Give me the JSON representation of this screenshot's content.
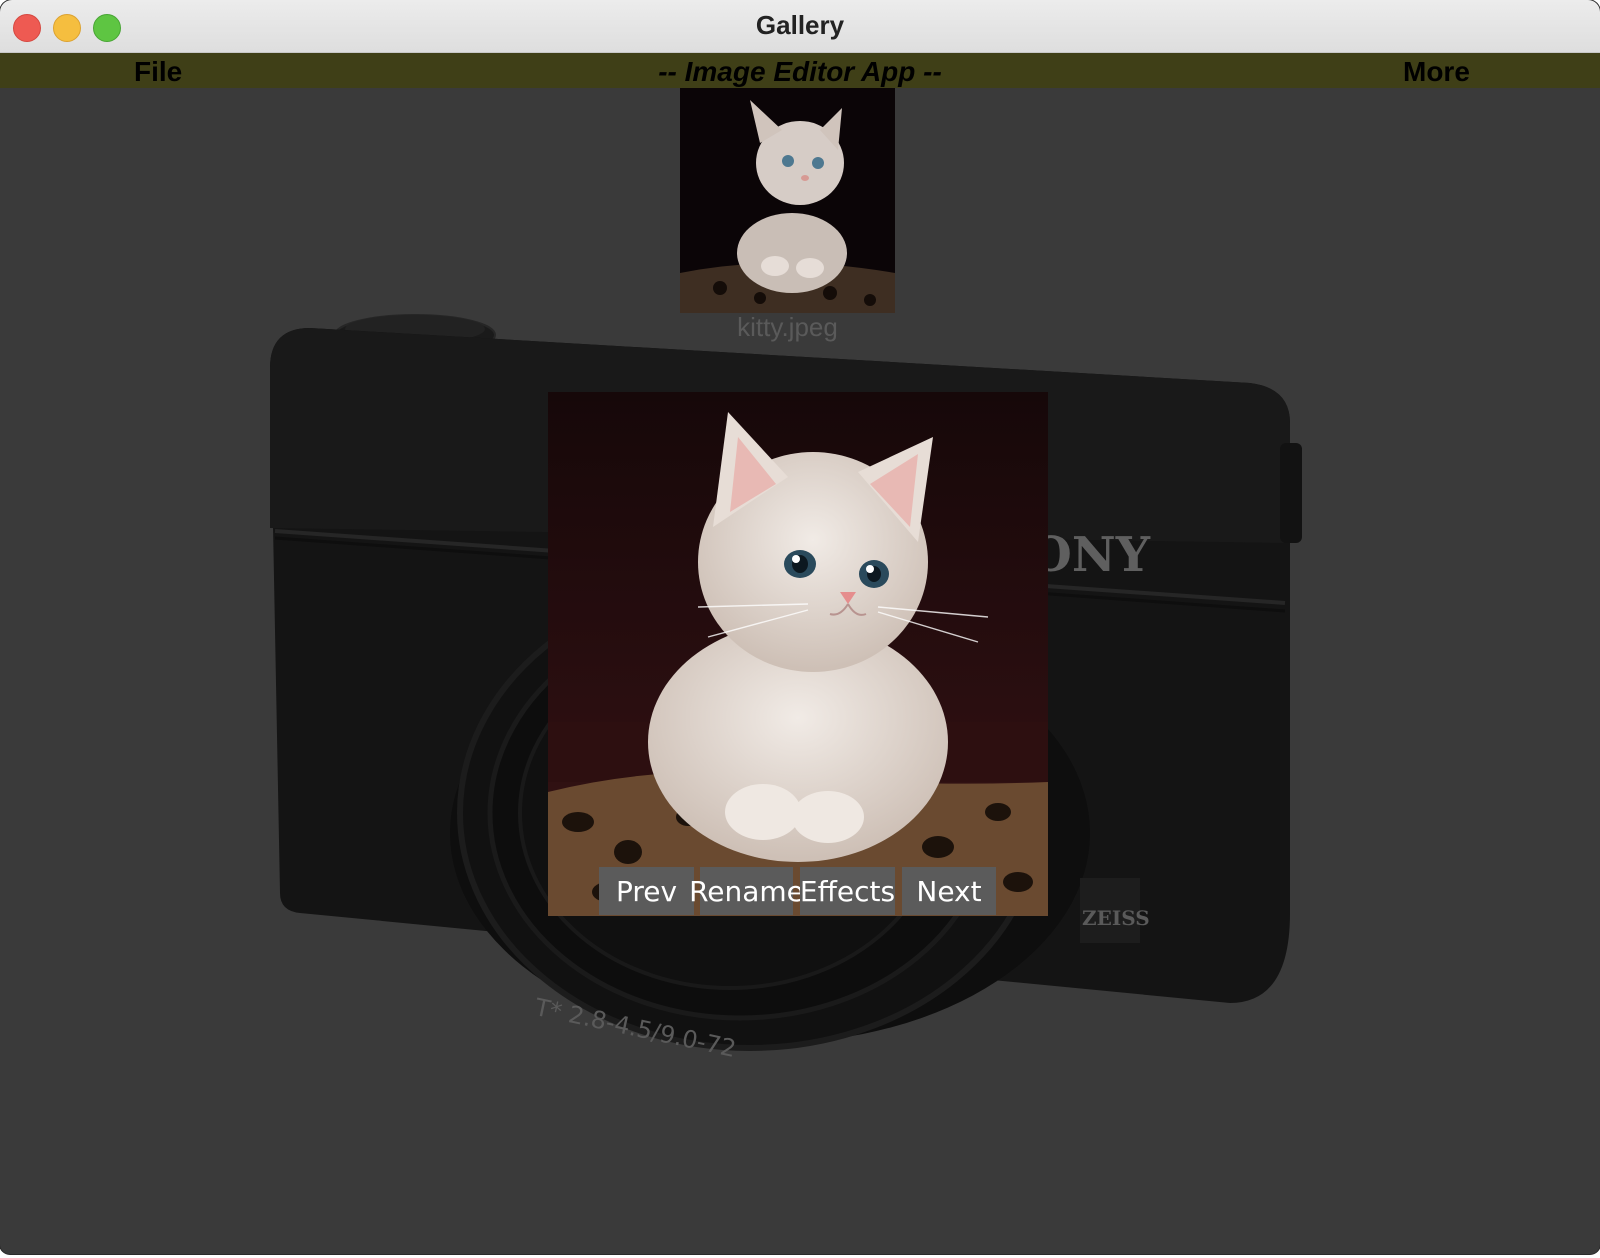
{
  "window": {
    "title": "Gallery"
  },
  "menubar": {
    "file_label": "File",
    "app_title": "-- Image Editor App --",
    "more_label": "More"
  },
  "gallery": {
    "thumbnail_caption": "kitty.jpeg",
    "camera_brand_text": "ONY",
    "lens_badge_text": "ZEISS",
    "lens_ring_text": "T* 2.8-4.5/9.0-72"
  },
  "controls": {
    "prev_label": "Prev",
    "rename_label": "Rename",
    "effects_label": "Effects",
    "next_label": "Next"
  },
  "colors": {
    "menubar_bg": "#3f3f17",
    "canvas_bg": "#3a3a3a",
    "button_bg": "#5b5b5b"
  }
}
